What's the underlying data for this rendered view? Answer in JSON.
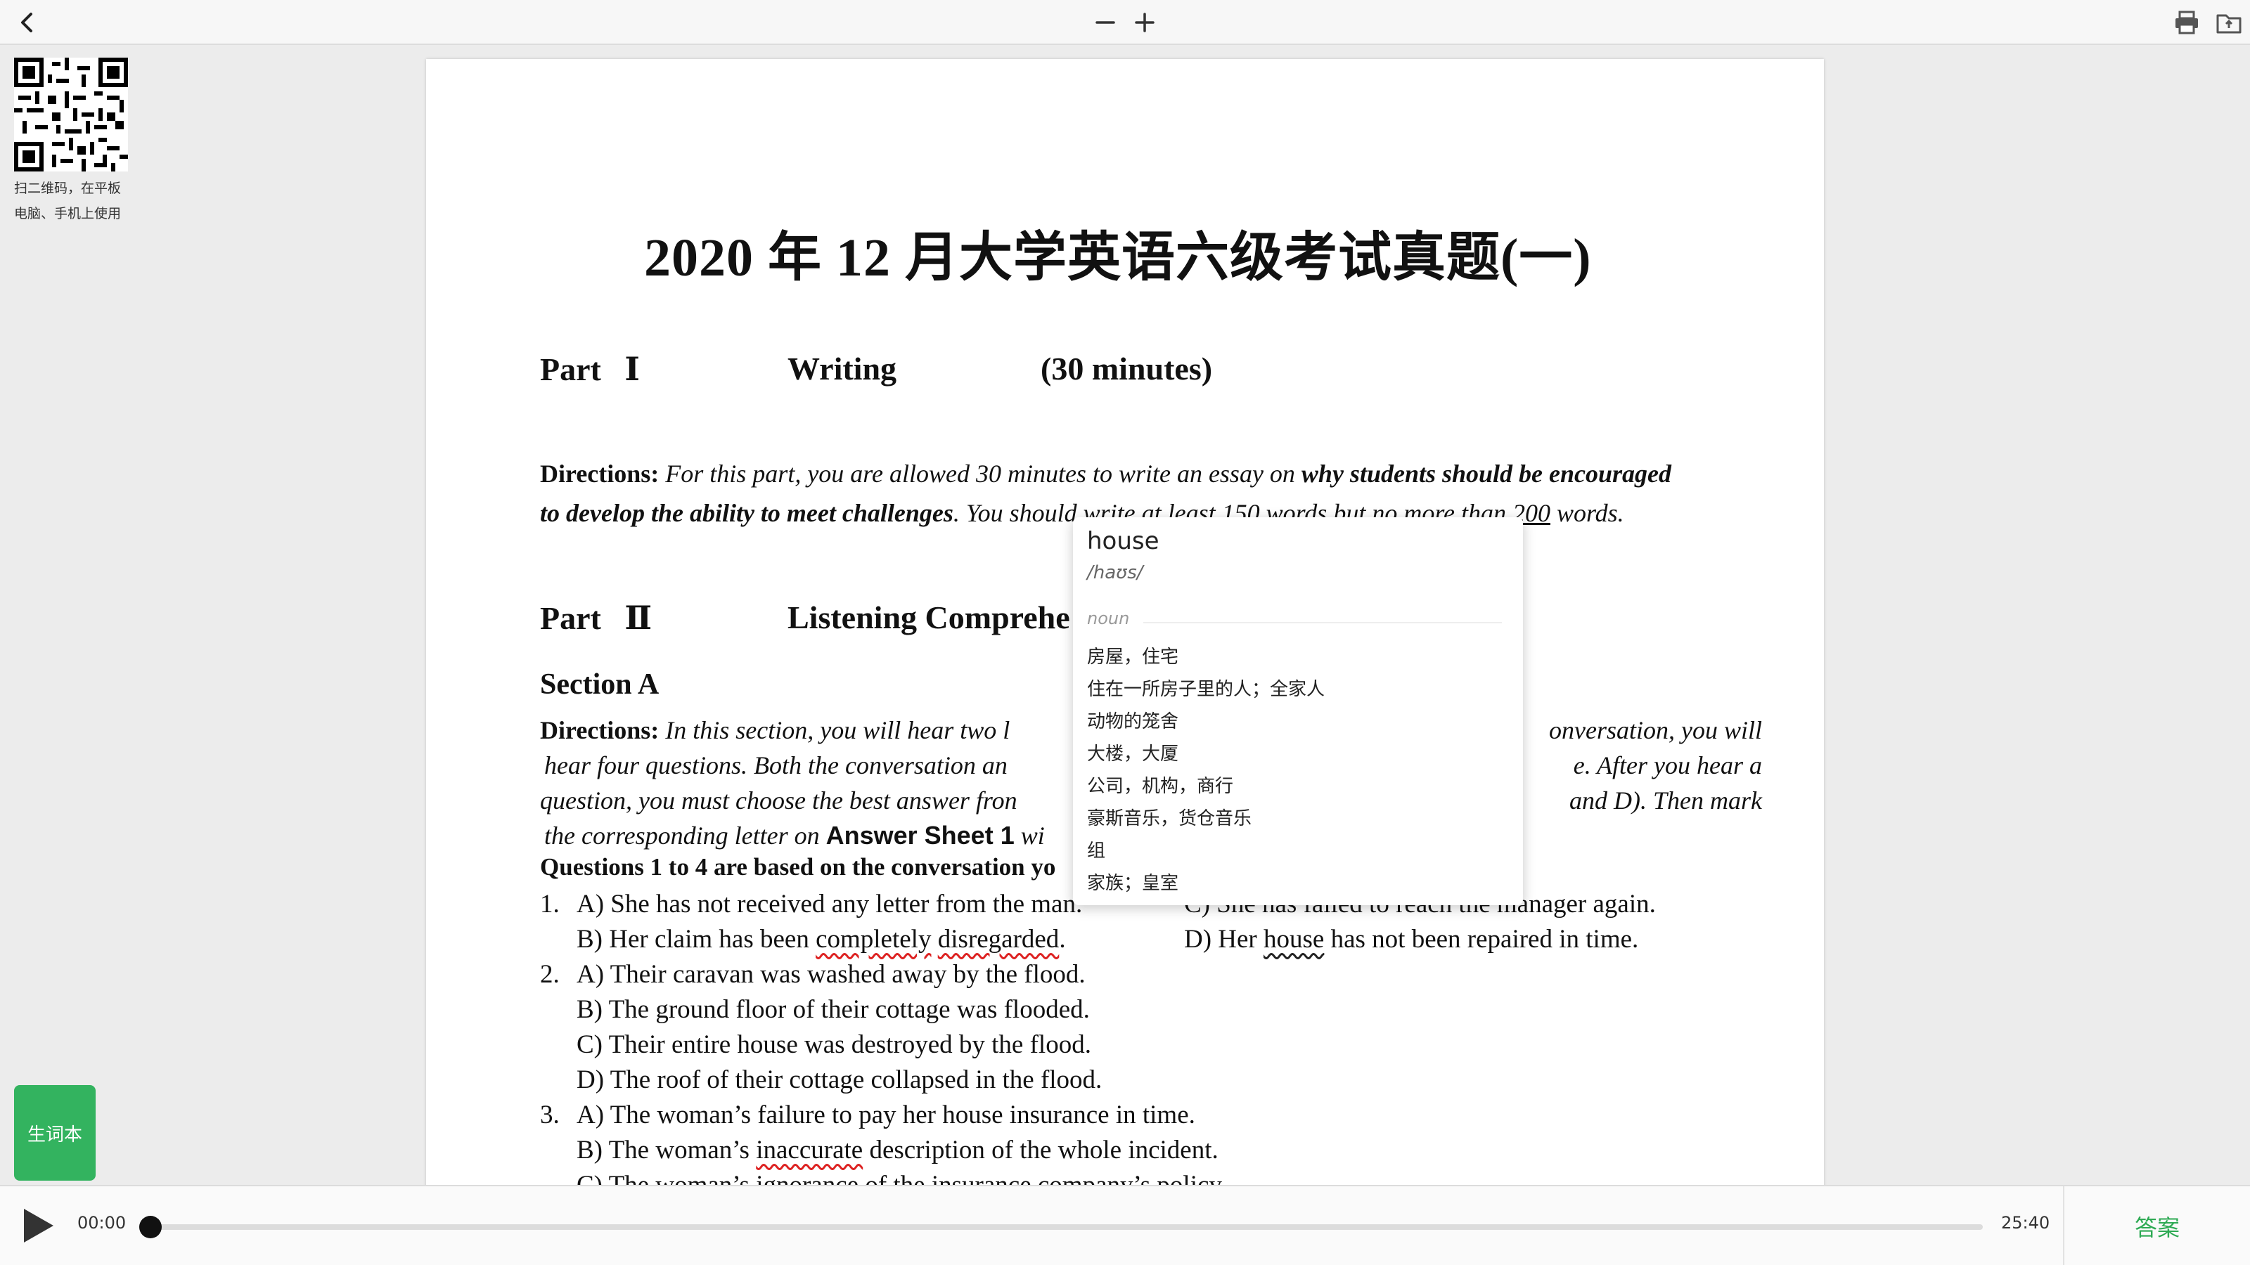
{
  "toolbar": {
    "back_icon": "chevron-left-icon",
    "zoom_out_icon": "minus-icon",
    "zoom_in_icon": "plus-icon",
    "print_icon": "printer-icon",
    "folder_icon": "folder-icon"
  },
  "qr": {
    "icon": "qr-code-icon",
    "caption_line1": "扫二维码，在平板",
    "caption_line2": "电脑、手机上使用"
  },
  "vocab_button": {
    "label": "生词本"
  },
  "document": {
    "title": "2020 年 12 月大学英语六级考试真题(一)",
    "part1": {
      "label": "Part",
      "numeral": "Ⅰ",
      "name": "Writing",
      "time": "(30 minutes)"
    },
    "directions1": {
      "lead": "Directions:",
      "line1_a": " For this part, you are allowed 30 minutes to write an essay on ",
      "line1_b": "why students should be encouraged",
      "line2_a": "to develop the ability to meet challenges",
      "line2_b": ". You ",
      "line2_c": "should write at least 150 words but no more than ",
      "line2_d": "200",
      "line2_e": " words."
    },
    "part2": {
      "label": "Part",
      "numeral": "Ⅱ",
      "name": "Listening Comprehe"
    },
    "section_a": "Section A",
    "directions2": {
      "lead": "Directions:",
      "line1_left": " In this section, you will hear two l",
      "line1_right": "onversation, you will",
      "line2_left": "hear four questions. Both the conversation an",
      "line2_right": "e. After you hear a",
      "line3_left": "question, you must choose the best answer fron",
      "line3_right": "and D). Then mark",
      "line4_left": "the corresponding letter on ",
      "line4_bold": "Answer Sheet 1",
      "line4_tail": " wi"
    },
    "questions_header": "Questions 1 to 4 are based on the conversation yo",
    "q1": {
      "num": "1.",
      "a": "A) She has not received any letter from the man.",
      "c": "C) She has failed to reach the manager again.",
      "b_pre": "B) Her claim has been ",
      "b_w1": "completely",
      "b_w2": "disregarded",
      "b_post": ".",
      "d_pre": "D) Her ",
      "d_word": "house",
      "d_post": " has not been repaired in time."
    },
    "q2": {
      "num": "2.",
      "a": "A) Their caravan was washed away by the flood.",
      "b": "B) The ground floor of their cottage was flooded.",
      "c": "C) Their entire house was destroyed by the flood.",
      "d": "D) The roof of their cottage collapsed in the flood."
    },
    "q3": {
      "num": "3.",
      "a": "A) The woman’s failure to pay her house insurance in time.",
      "b_pre": "B) The woman’s ",
      "b_word": "inaccurate",
      "b_post": " description of the whole incident.",
      "c": "C) The woman’s ignorance of the insurance company’s policy."
    }
  },
  "dictionary": {
    "word": "house",
    "phonetic": "/haʊs/",
    "pos": "noun",
    "definitions": [
      "房屋，住宅",
      "住在一所房子里的人；全家人",
      "动物的笼舍",
      "大楼，大厦",
      "公司，机构，商行",
      "豪斯音乐，货仓音乐",
      "组",
      "家族；皇室"
    ]
  },
  "player": {
    "play_icon": "play-icon",
    "current_time": "00:00",
    "total_time": "25:40",
    "progress": 0,
    "answer_label": "答案"
  },
  "colors": {
    "accent_green": "#33b35f",
    "answer_green": "#2eaa54",
    "error_underline": "#d22222"
  }
}
